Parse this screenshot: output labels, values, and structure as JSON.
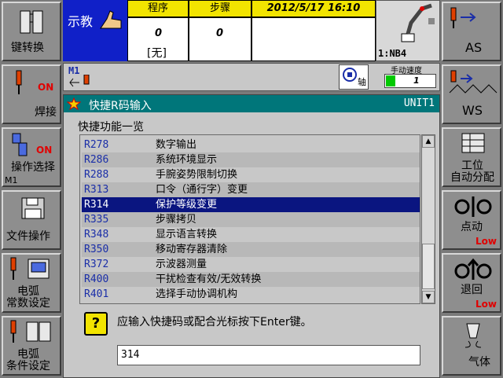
{
  "status": {
    "mode_label": "示教",
    "program_header": "程序",
    "program_value": "0",
    "program_sub": "[无]",
    "step_header": "步骤",
    "step_value": "0",
    "datetime": "2012/5/17  16:10",
    "robot_name": "1:NB4",
    "mech_label": "M1",
    "axis_label": "轴",
    "speed_label": "手动速度",
    "speed_value": "1"
  },
  "left_buttons": [
    {
      "label": "键转换"
    },
    {
      "label": "焊接",
      "badge": "ON"
    },
    {
      "label": "操作选择",
      "badge": "ON",
      "sub": "M1"
    },
    {
      "label": "文件操作"
    },
    {
      "label": "电弧\n常数设定"
    },
    {
      "label": "电弧\n条件设定"
    }
  ],
  "right_buttons": [
    {
      "label": "AS"
    },
    {
      "label": "WS"
    },
    {
      "label": "工位\n自动分配"
    },
    {
      "label": "点动",
      "badge": "Low"
    },
    {
      "label": "退回",
      "badge": "Low"
    },
    {
      "label": "气体"
    }
  ],
  "dialog": {
    "title": "快捷R码输入",
    "unit": "UNIT1",
    "heading": "快捷功能一览",
    "items": [
      {
        "code": "R278",
        "name": "数字输出"
      },
      {
        "code": "R286",
        "name": "系统环境显示"
      },
      {
        "code": "R288",
        "name": "手腕姿势限制切换"
      },
      {
        "code": "R313",
        "name": "口令（通行字）变更"
      },
      {
        "code": "R314",
        "name": "保护等级变更",
        "selected": true
      },
      {
        "code": "R335",
        "name": "步骤拷贝"
      },
      {
        "code": "R348",
        "name": "显示语言转换"
      },
      {
        "code": "R350",
        "name": "移动寄存器清除"
      },
      {
        "code": "R372",
        "name": "示波器测量"
      },
      {
        "code": "R400",
        "name": "干扰检查有效/无效转换"
      },
      {
        "code": "R401",
        "name": "选择手动协调机构"
      }
    ],
    "prompt": "应输入快捷码或配合光标按下Enter键。",
    "input_value": "314"
  },
  "colors": {
    "mode_bg": "#1020c8",
    "header_yellow": "#f2e400",
    "title_teal": "#00767a",
    "selected_row": "#0a1580",
    "code_blue": "#1a2ea8",
    "badge_red": "#e00000"
  }
}
